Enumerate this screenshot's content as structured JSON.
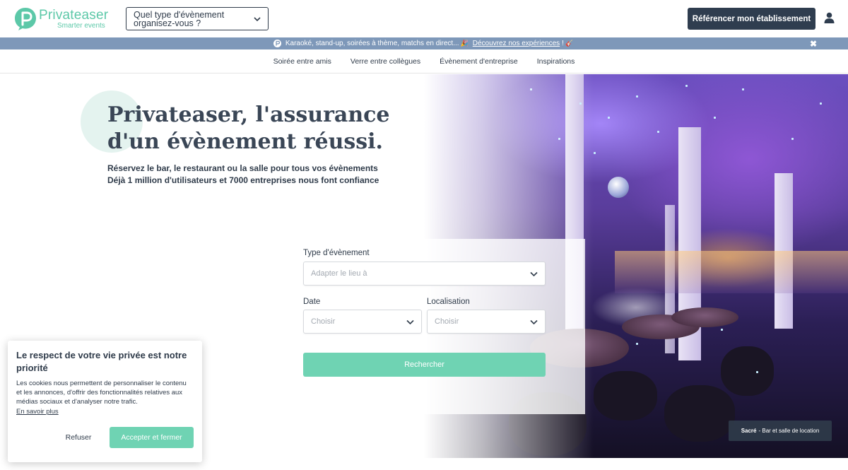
{
  "header": {
    "logo_name": "Privateaser",
    "logo_tagline": "Smarter events",
    "event_type_select": "Quel type d'évènement organisez-vous ?",
    "list_button": "Référencer mon établissement"
  },
  "promo": {
    "text": "Karaoké, stand-up, soirées à thème, matchs en direct...",
    "link": "Découvrez nos expériences",
    "suffix": "!"
  },
  "nav": {
    "items": [
      "Soirée entre amis",
      "Verre entre collègues",
      "Évènement d'entreprise",
      "Inspirations"
    ]
  },
  "hero": {
    "title": "Privateaser, l'assurance d'un évènement réussi.",
    "subtitle_line1": "Réservez le bar, le restaurant ou la salle pour tous vos évènements",
    "subtitle_line2": "Déjà 1 million d'utilisateurs et 7000 entreprises nous font confiance",
    "credit_name": "Sacré",
    "credit_desc": "- Bar et salle de location"
  },
  "search": {
    "event_label": "Type d'évènement",
    "event_placeholder": "Adapter le lieu à",
    "date_label": "Date",
    "date_placeholder": "Choisir",
    "location_label": "Localisation",
    "location_placeholder": "Choisir",
    "button": "Rechercher"
  },
  "cookie": {
    "title": "Le respect de votre vie privée est notre priorité",
    "text": "Les cookies nous permettent de personnaliser le contenu et les annonces, d'offrir des fonctionnalités relatives aux médias sociaux et d'analyser notre trafic.",
    "link": "En savoir plus",
    "refuse": "Refuser",
    "accept": "Accepter et fermer"
  },
  "colors": {
    "brand_green": "#5cc8a8",
    "button_green": "#6fd3b3",
    "navy": "#2f3d4f",
    "promo_bar": "#7e98b9"
  },
  "icons": {
    "logo": "privateaser-p-icon",
    "chevron": "chevron-down-icon",
    "user": "user-icon",
    "close": "close-icon"
  }
}
